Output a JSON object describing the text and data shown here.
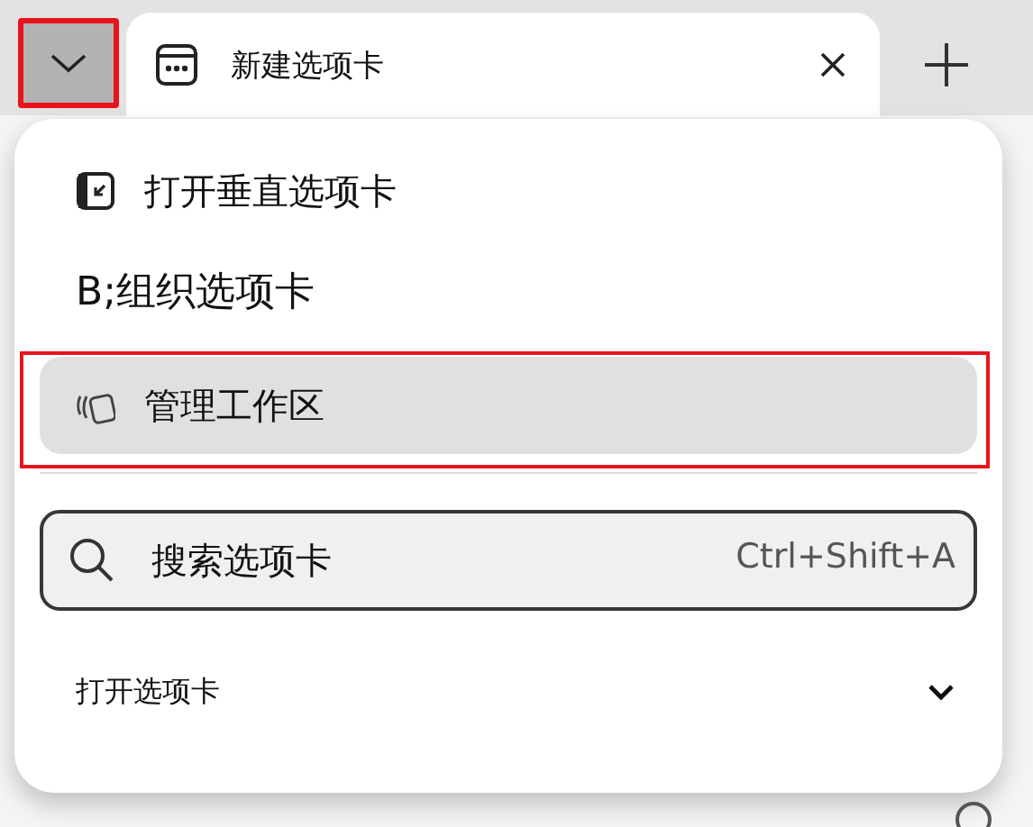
{
  "tab_strip": {
    "tab_actions_open": true,
    "tab": {
      "title": "新建选项卡"
    }
  },
  "menu": {
    "items": [
      {
        "kind": "vertical-tabs",
        "label": "打开垂直选项卡",
        "selected": false
      },
      {
        "kind": "plain",
        "label": "B;组织选项卡",
        "selected": false
      },
      {
        "kind": "workspaces",
        "label": "管理工作区",
        "selected": true
      }
    ],
    "search": {
      "placeholder": "搜索选项卡",
      "shortcut": "Ctrl+Shift+A"
    },
    "section": {
      "label": "打开选项卡",
      "expanded": false
    }
  }
}
